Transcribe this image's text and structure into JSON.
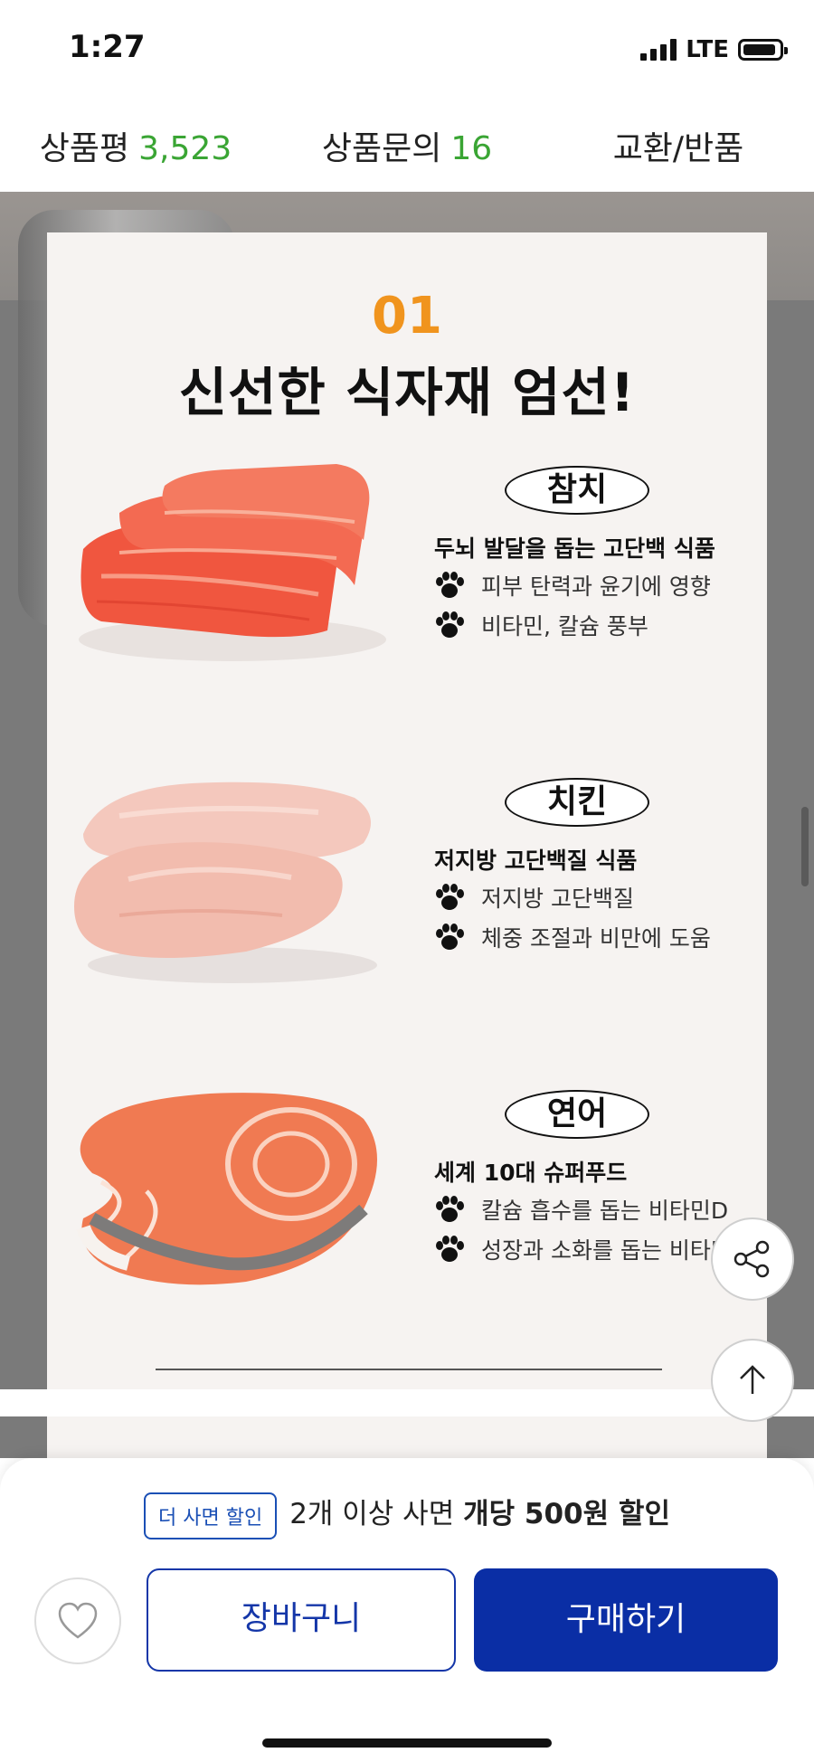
{
  "status_bar": {
    "time": "1:27",
    "network": "LTE"
  },
  "tabs": [
    {
      "label": "상품평",
      "count": "3,523"
    },
    {
      "label": "상품문의",
      "count": "16"
    },
    {
      "label": "교환/반품",
      "count": ""
    }
  ],
  "section": {
    "number": "01",
    "headline": "신선한 식자재 엄선!",
    "items": [
      {
        "name": "참치",
        "subtitle": "두뇌 발달을 돕는 고단백 식품",
        "bullets": [
          "피부 탄력과 윤기에 영향",
          "비타민, 칼슘 풍부"
        ]
      },
      {
        "name": "치킨",
        "subtitle": "저지방 고단백질 식품",
        "bullets": [
          "저지방 고단백질",
          "체중 조절과 비만에 도움"
        ]
      },
      {
        "name": "연어",
        "subtitle": "세계 10대 슈퍼푸드",
        "bullets": [
          "칼슘 흡수를 돕는 비타민D",
          "성장과 소화를 돕는 비타민"
        ]
      }
    ]
  },
  "bottom_bar": {
    "promo_badge": "더 사면 할인",
    "promo_text": "2개 이상 사면",
    "promo_strong": "개당 500원 할인",
    "cart_label": "장바구니",
    "buy_label": "구매하기"
  },
  "icons": {
    "share": "share-icon",
    "scroll_top": "arrow-up-icon",
    "wishlist": "heart-icon",
    "bullet": "paw-icon"
  },
  "colors": {
    "accent_green": "#3aa534",
    "number_orange": "#f0941e",
    "primary_blue": "#0a2ea5"
  }
}
